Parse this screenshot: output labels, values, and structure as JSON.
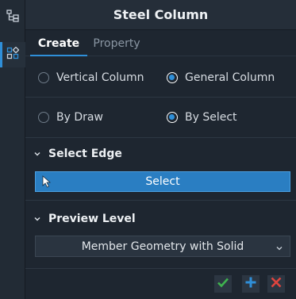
{
  "sidebar": {
    "items": [
      {
        "icon": "tree-icon",
        "active": false
      },
      {
        "icon": "grid-layers-icon",
        "active": true
      }
    ]
  },
  "panel": {
    "title": "Steel Column",
    "tabs": [
      {
        "label": "Create",
        "active": true
      },
      {
        "label": "Property",
        "active": false
      }
    ],
    "column_type": {
      "options": [
        {
          "label": "Vertical Column",
          "checked": false
        },
        {
          "label": "General Column",
          "checked": true
        }
      ]
    },
    "method": {
      "options": [
        {
          "label": "By Draw",
          "checked": false
        },
        {
          "label": "By Select",
          "checked": true
        }
      ]
    },
    "select_edge": {
      "heading": "Select Edge",
      "button_label": "Select"
    },
    "preview_level": {
      "heading": "Preview Level",
      "selected": "Member Geometry with Solid"
    }
  },
  "footer": {
    "buttons": [
      {
        "icon": "check-icon",
        "color": "#3fb34f"
      },
      {
        "icon": "plus-icon",
        "color": "#2f8fd8"
      },
      {
        "icon": "close-icon",
        "color": "#e0443e"
      }
    ]
  }
}
